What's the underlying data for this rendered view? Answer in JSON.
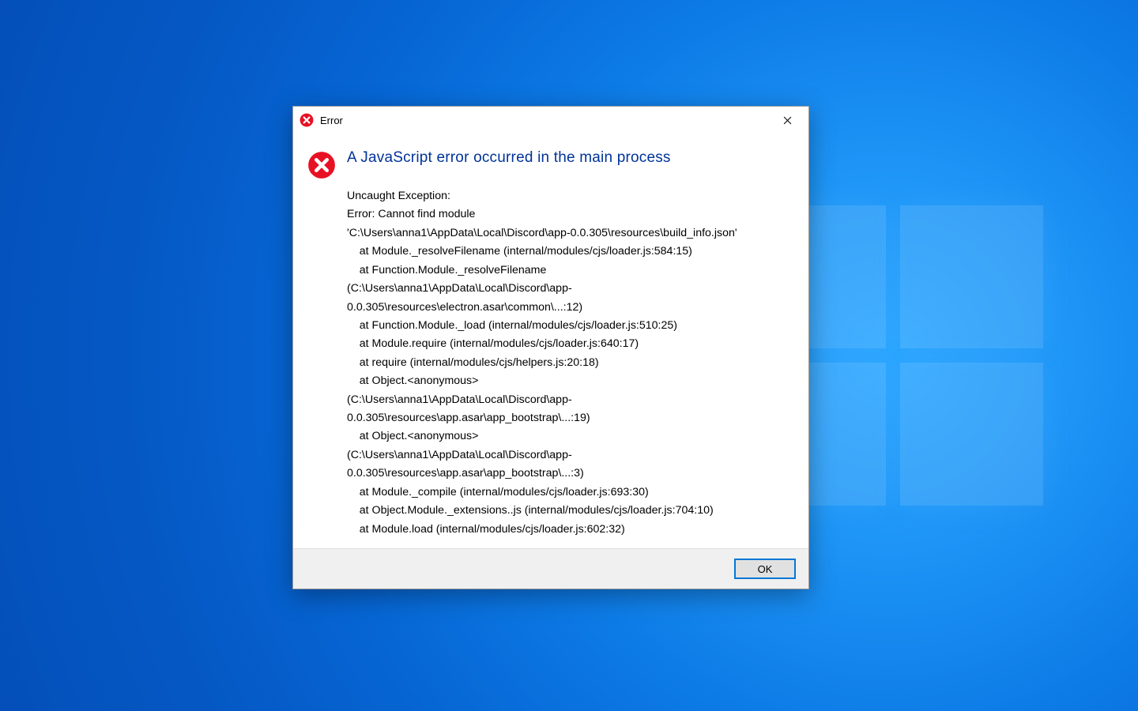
{
  "titlebar": {
    "title": "Error"
  },
  "dialog": {
    "heading": "A JavaScript error occurred in the main process",
    "message": "Uncaught Exception:\nError: Cannot find module\n'C:\\Users\\anna1\\AppData\\Local\\Discord\\app-0.0.305\\resources\\build_info.json'\n    at Module._resolveFilename (internal/modules/cjs/loader.js:584:15)\n    at Function.Module._resolveFilename\n(C:\\Users\\anna1\\AppData\\Local\\Discord\\app-0.0.305\\resources\\electron.asar\\common\\...:12)\n    at Function.Module._load (internal/modules/cjs/loader.js:510:25)\n    at Module.require (internal/modules/cjs/loader.js:640:17)\n    at require (internal/modules/cjs/helpers.js:20:18)\n    at Object.<anonymous>\n(C:\\Users\\anna1\\AppData\\Local\\Discord\\app-0.0.305\\resources\\app.asar\\app_bootstrap\\...:19)\n    at Object.<anonymous>\n(C:\\Users\\anna1\\AppData\\Local\\Discord\\app-0.0.305\\resources\\app.asar\\app_bootstrap\\...:3)\n    at Module._compile (internal/modules/cjs/loader.js:693:30)\n    at Object.Module._extensions..js (internal/modules/cjs/loader.js:704:10)\n    at Module.load (internal/modules/cjs/loader.js:602:32)"
  },
  "footer": {
    "ok_label": "OK"
  }
}
